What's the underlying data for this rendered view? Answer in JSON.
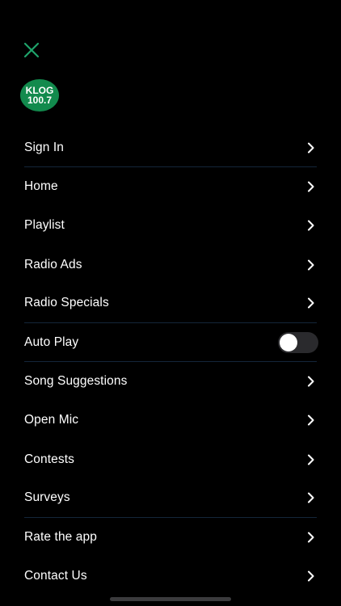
{
  "logo": {
    "line1": "KLOG",
    "line2": "100.7"
  },
  "colors": {
    "accent": "#1fa36b",
    "logo_bg": "#128a4d",
    "divider": "#14263a"
  },
  "menu": {
    "items": [
      {
        "label": "Sign In",
        "type": "link",
        "divider": true
      },
      {
        "label": "Home",
        "type": "link",
        "divider": false
      },
      {
        "label": "Playlist",
        "type": "link",
        "divider": false
      },
      {
        "label": "Radio Ads",
        "type": "link",
        "divider": false
      },
      {
        "label": "Radio Specials",
        "type": "link",
        "divider": true
      },
      {
        "label": "Auto Play",
        "type": "toggle",
        "toggle_on": false,
        "divider": true
      },
      {
        "label": "Song Suggestions",
        "type": "link",
        "divider": false
      },
      {
        "label": "Open Mic",
        "type": "link",
        "divider": false
      },
      {
        "label": "Contests",
        "type": "link",
        "divider": false
      },
      {
        "label": "Surveys",
        "type": "link",
        "divider": true
      },
      {
        "label": "Rate the app",
        "type": "link",
        "divider": false
      },
      {
        "label": "Contact Us",
        "type": "link",
        "divider": false
      }
    ]
  }
}
